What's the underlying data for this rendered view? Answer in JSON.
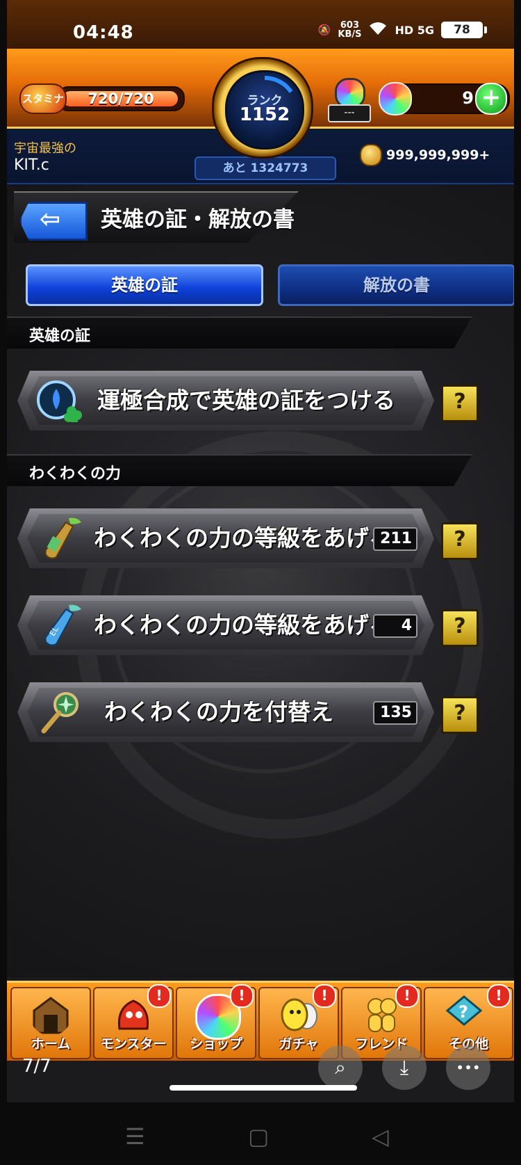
{
  "status_bar": {
    "time": "04:48",
    "net_speed_value": "603",
    "net_speed_unit": "KB/S",
    "network": "HD 5G",
    "battery": "78"
  },
  "header": {
    "stamina_label": "スタミナ",
    "stamina_value": "720/720",
    "stamina_fraction": 1.0,
    "rank_label": "ランク",
    "rank_value": "1152",
    "egg_plate": "---",
    "orb_count": "9",
    "plus_symbol": "+"
  },
  "player": {
    "title": "宇宙最強の",
    "name": "KIT.c",
    "next_rank": "あと 1324773",
    "gold": "999,999,999+"
  },
  "page": {
    "title": "英雄の証・解放の書",
    "back_symbol": "⇦"
  },
  "tabs": [
    {
      "label": "英雄の証",
      "active": true
    },
    {
      "label": "解放の書",
      "active": false
    }
  ],
  "sections": {
    "hero": "英雄の証",
    "wakuwaku": "わくわくの力"
  },
  "actions": [
    {
      "label": "運極合成で英雄の証をつける",
      "count": null,
      "icon": "hero-badge-icon"
    },
    {
      "label": "わくわくの力の等級をあげる",
      "count": "211",
      "icon": "green-bottle-icon"
    },
    {
      "label": "わくわくの力の等級をあげる",
      "count": "4",
      "icon": "blue-el-bottle-icon"
    },
    {
      "label": "わくわくの力を付替え",
      "count": "135",
      "icon": "wand-icon"
    }
  ],
  "help_symbol": "?",
  "nav": [
    {
      "label": "ホーム",
      "alert": false,
      "icon": "home-gate-icon"
    },
    {
      "label": "モンスター",
      "alert": true,
      "icon": "monster-icon"
    },
    {
      "label": "ショップ",
      "alert": true,
      "icon": "rainbow-orb-icon"
    },
    {
      "label": "ガチャ",
      "alert": true,
      "icon": "egg-icon"
    },
    {
      "label": "フレンド",
      "alert": true,
      "icon": "friends-icon"
    },
    {
      "label": "その他",
      "alert": true,
      "icon": "other-icon"
    }
  ],
  "alert_symbol": "!",
  "overlay": {
    "page_indicator": "7/7",
    "search_symbol": "⌕",
    "download_symbol": "⤓",
    "more_symbol": "•••"
  },
  "system_nav": {
    "menu_symbol": "☰",
    "home_symbol": "▢",
    "back_symbol": "◁"
  },
  "colors": {
    "header_orange": "#e46c08",
    "tab_blue": "#0d3fd8",
    "help_yellow": "#f7e25a",
    "gold_text": "#f3c247"
  }
}
